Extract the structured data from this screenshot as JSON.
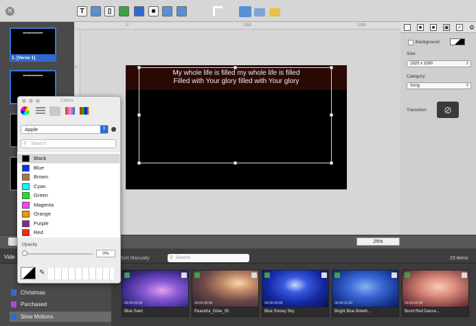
{
  "toolbar": {
    "icons": [
      "text-icon",
      "image-icon",
      "shape-icon",
      "media-icon",
      "web-icon",
      "camera-icon",
      "slides-icon",
      "textbox-icon",
      "corner-icon",
      "layers-icon",
      "folder-icon"
    ]
  },
  "ruler": {
    "t1": "0",
    "t2": "1,000",
    "t3": "2,000",
    "l1": "0"
  },
  "slides": [
    {
      "caption": "1. [Verse 1]"
    }
  ],
  "slide": {
    "line1": "My whole life is filled my whole life is filled",
    "line2": "Filled with Your glory filled with Your glory"
  },
  "inspector": {
    "background_label": "Background",
    "size_label": "Size:",
    "size_value": "1920 x 1080",
    "category_label": "Category:",
    "category_value": "Song",
    "transition_label": "Transition:"
  },
  "zoom": "25%",
  "colors_panel": {
    "title": "Colors",
    "palette": "Apple",
    "search_placeholder": "Search",
    "opacity_label": "Opacity",
    "opacity_value": "0%",
    "items": [
      {
        "name": "Black",
        "color": "#000000"
      },
      {
        "name": "Blue",
        "color": "#0433ff"
      },
      {
        "name": "Brown",
        "color": "#aa7942"
      },
      {
        "name": "Cyan",
        "color": "#00fdff"
      },
      {
        "name": "Green",
        "color": "#00f900"
      },
      {
        "name": "Magenta",
        "color": "#ff40ff"
      },
      {
        "name": "Orange",
        "color": "#ff9300"
      },
      {
        "name": "Purple",
        "color": "#942192"
      },
      {
        "name": "Red",
        "color": "#ff2600"
      }
    ]
  },
  "media": {
    "header_left": "Vide",
    "sort_label": "Sort Manually",
    "search_placeholder": "Search",
    "count": "23 items",
    "library": [
      {
        "name": "Christmas",
        "color": "#2f6ad0"
      },
      {
        "name": "Purchased",
        "color": "#a050d0"
      },
      {
        "name": "Slow Motions",
        "color": "#2f6ad0"
      }
    ],
    "clips": [
      {
        "name": "Blue Swirl",
        "time": "00:00:20:00"
      },
      {
        "name": "Peaceful_Glow_05",
        "time": "00:00:30:00"
      },
      {
        "name": "Blue Snowy Sky",
        "time": "00:00:20:00"
      },
      {
        "name": "Bright Blue Bokeh…",
        "time": "00:00:11:00"
      },
      {
        "name": "Burnt Red Dance…",
        "time": "00:00:20:00"
      }
    ]
  }
}
